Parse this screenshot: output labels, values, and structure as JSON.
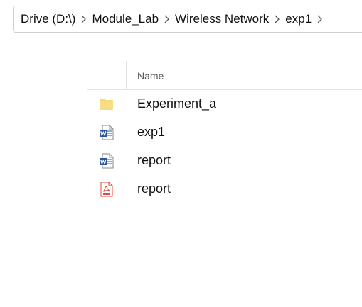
{
  "breadcrumb": {
    "items": [
      {
        "label": "Drive (D:\\)"
      },
      {
        "label": "Module_Lab"
      },
      {
        "label": "Wireless Network"
      },
      {
        "label": "exp1"
      }
    ]
  },
  "file_list": {
    "columns": {
      "name": "Name"
    },
    "items": [
      {
        "name": "Experiment_a",
        "icon": "folder-icon"
      },
      {
        "name": "exp1",
        "icon": "word-doc-icon"
      },
      {
        "name": "report",
        "icon": "word-doc-icon"
      },
      {
        "name": "report",
        "icon": "pdf-icon"
      }
    ]
  },
  "colors": {
    "folder": "#F8D775",
    "word": "#2B579A",
    "pdf": "#E24A3B"
  }
}
